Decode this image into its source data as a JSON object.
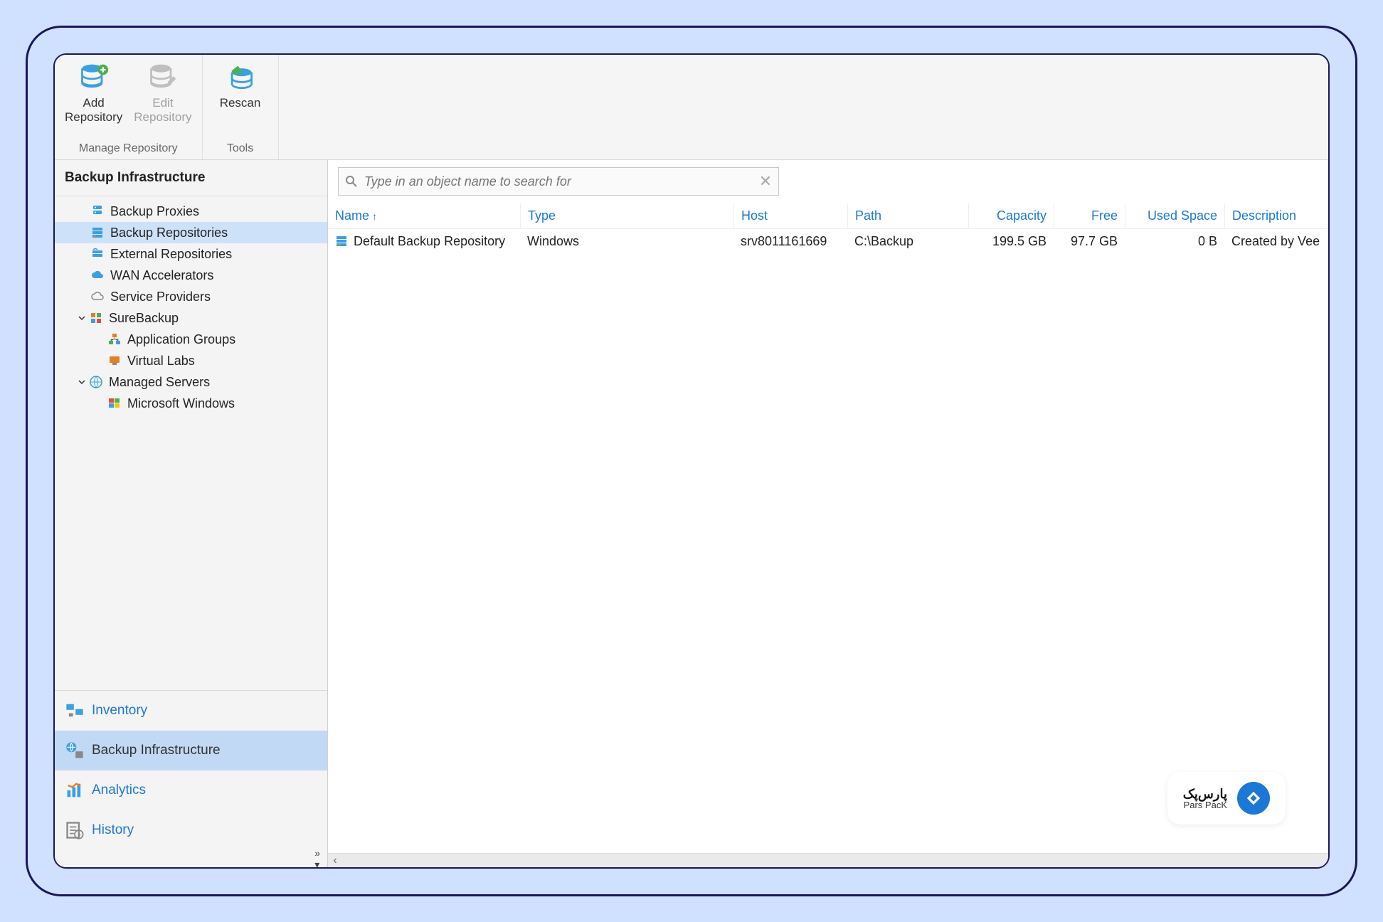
{
  "ribbon": {
    "groups": [
      {
        "label": "Manage Repository",
        "buttons": [
          {
            "id": "add-repository-button",
            "line1": "Add",
            "line2": "Repository",
            "disabled": false,
            "icon": "db-add"
          },
          {
            "id": "edit-repository-button",
            "line1": "Edit",
            "line2": "Repository",
            "disabled": true,
            "icon": "db-edit"
          }
        ]
      },
      {
        "label": "Tools",
        "buttons": [
          {
            "id": "rescan-button",
            "line1": "Rescan",
            "line2": "",
            "disabled": false,
            "icon": "db-rescan"
          }
        ]
      }
    ]
  },
  "sidebar": {
    "title": "Backup Infrastructure",
    "tree": [
      {
        "id": "backup-proxies",
        "label": "Backup Proxies",
        "level": 0,
        "icon": "proxy",
        "expander": null,
        "selected": false
      },
      {
        "id": "backup-repositories",
        "label": "Backup Repositories",
        "level": 0,
        "icon": "repo",
        "expander": null,
        "selected": true
      },
      {
        "id": "external-repositories",
        "label": "External Repositories",
        "level": 0,
        "icon": "extrepo",
        "expander": null,
        "selected": false
      },
      {
        "id": "wan-accelerators",
        "label": "WAN Accelerators",
        "level": 0,
        "icon": "cloud",
        "expander": null,
        "selected": false
      },
      {
        "id": "service-providers",
        "label": "Service Providers",
        "level": 0,
        "icon": "service",
        "expander": null,
        "selected": false
      },
      {
        "id": "surebackup",
        "label": "SureBackup",
        "level": 0,
        "icon": "sure",
        "expander": "open",
        "selected": false
      },
      {
        "id": "application-groups",
        "label": "Application Groups",
        "level": 1,
        "icon": "appgrp",
        "expander": null,
        "selected": false
      },
      {
        "id": "virtual-labs",
        "label": "Virtual Labs",
        "level": 1,
        "icon": "vlab",
        "expander": null,
        "selected": false
      },
      {
        "id": "managed-servers",
        "label": "Managed Servers",
        "level": 0,
        "icon": "servers",
        "expander": "open",
        "selected": false
      },
      {
        "id": "microsoft-windows",
        "label": "Microsoft Windows",
        "level": 1,
        "icon": "mswin",
        "expander": null,
        "selected": false
      }
    ],
    "bottom_nav": [
      {
        "id": "inventory",
        "label": "Inventory",
        "selected": false
      },
      {
        "id": "backup-infrastructure",
        "label": "Backup Infrastructure",
        "selected": true
      },
      {
        "id": "analytics",
        "label": "Analytics",
        "selected": false
      },
      {
        "id": "history",
        "label": "History",
        "selected": false
      }
    ]
  },
  "search": {
    "placeholder": "Type in an object name to search for"
  },
  "grid": {
    "columns": [
      {
        "key": "name",
        "label": "Name",
        "sort": "asc"
      },
      {
        "key": "type",
        "label": "Type"
      },
      {
        "key": "host",
        "label": "Host"
      },
      {
        "key": "path",
        "label": "Path"
      },
      {
        "key": "capacity",
        "label": "Capacity"
      },
      {
        "key": "free",
        "label": "Free"
      },
      {
        "key": "used",
        "label": "Used Space"
      },
      {
        "key": "description",
        "label": "Description"
      }
    ],
    "rows": [
      {
        "name": "Default Backup Repository",
        "type": "Windows",
        "host": "srv8011161669",
        "path": "C:\\Backup",
        "capacity": "199.5 GB",
        "free": "97.7 GB",
        "used": "0 B",
        "description": "Created by Vee"
      }
    ]
  },
  "brand": {
    "name": "پارس‌پک",
    "sub": "Pars PacK"
  }
}
